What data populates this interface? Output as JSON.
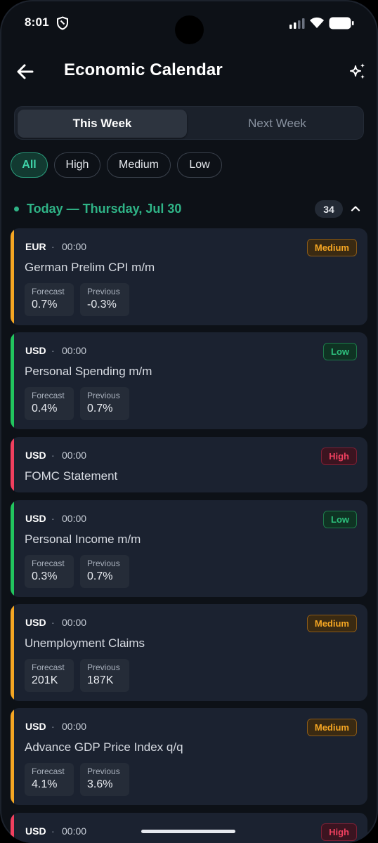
{
  "status_bar": {
    "time": "8:01"
  },
  "header": {
    "title": "Economic Calendar"
  },
  "week_tabs": [
    {
      "label": "This Week",
      "active": true
    },
    {
      "label": "Next Week",
      "active": false
    }
  ],
  "filters": [
    {
      "label": "All",
      "active": true
    },
    {
      "label": "High",
      "active": false
    },
    {
      "label": "Medium",
      "active": false
    },
    {
      "label": "Low",
      "active": false
    }
  ],
  "section": {
    "title": "Today — Thursday, Jul 30",
    "count": "34"
  },
  "impact_colors": {
    "Medium": "#f5a623",
    "Low": "#22c55e",
    "High": "#f0405f"
  },
  "events": [
    {
      "currency": "EUR",
      "separator": "·",
      "time": "00:00",
      "impact": "Medium",
      "name": "German Prelim CPI m/m",
      "forecast_label": "Forecast",
      "forecast": "0.7%",
      "previous_label": "Previous",
      "previous": "-0.3%"
    },
    {
      "currency": "USD",
      "separator": "·",
      "time": "00:00",
      "impact": "Low",
      "name": "Personal Spending m/m",
      "forecast_label": "Forecast",
      "forecast": "0.4%",
      "previous_label": "Previous",
      "previous": "0.7%"
    },
    {
      "currency": "USD",
      "separator": "·",
      "time": "00:00",
      "impact": "High",
      "name": "FOMC Statement"
    },
    {
      "currency": "USD",
      "separator": "·",
      "time": "00:00",
      "impact": "Low",
      "name": "Personal Income m/m",
      "forecast_label": "Forecast",
      "forecast": "0.3%",
      "previous_label": "Previous",
      "previous": "0.7%"
    },
    {
      "currency": "USD",
      "separator": "·",
      "time": "00:00",
      "impact": "Medium",
      "name": "Unemployment Claims",
      "forecast_label": "Forecast",
      "forecast": "201K",
      "previous_label": "Previous",
      "previous": "187K"
    },
    {
      "currency": "USD",
      "separator": "·",
      "time": "00:00",
      "impact": "Medium",
      "name": "Advance GDP Price Index q/q",
      "forecast_label": "Forecast",
      "forecast": "4.1%",
      "previous_label": "Previous",
      "previous": "3.6%"
    },
    {
      "currency": "USD",
      "separator": "·",
      "time": "00:00",
      "impact": "High"
    }
  ]
}
